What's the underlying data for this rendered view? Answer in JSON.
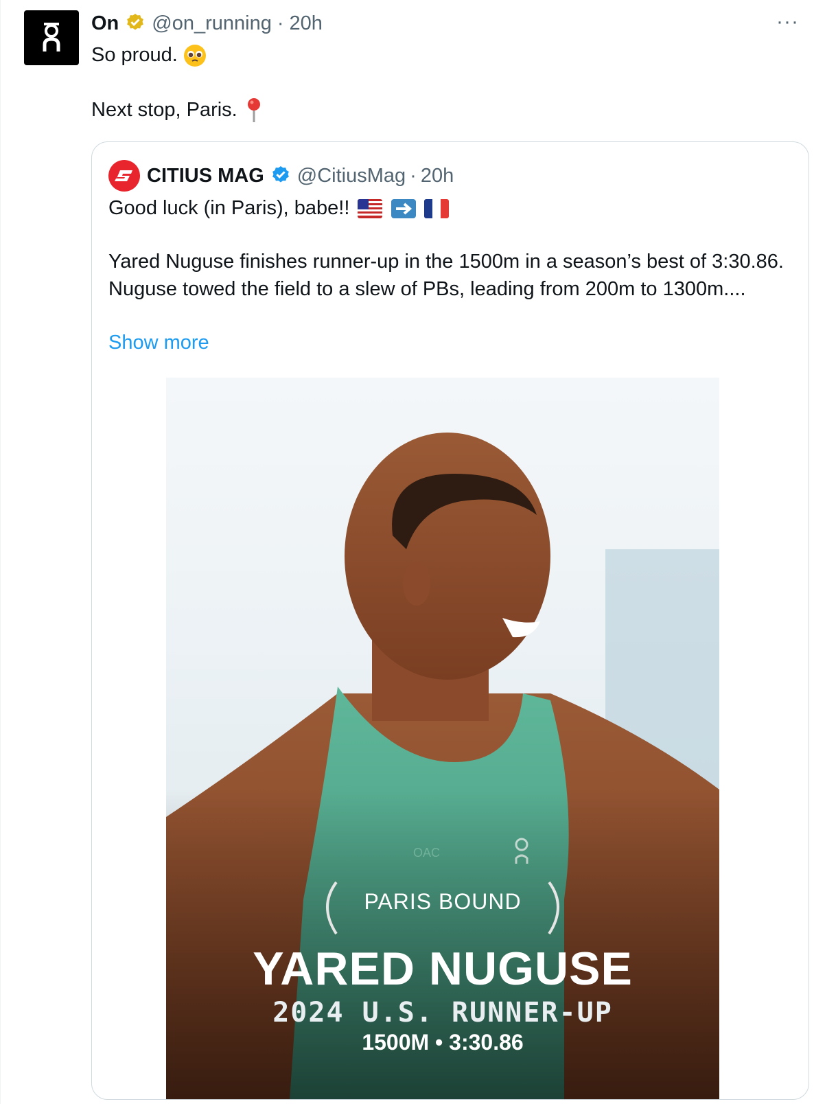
{
  "tweet": {
    "author_name": "On",
    "handle": "@on_running",
    "time": "20h",
    "more_label": "···",
    "line1": "So proud.",
    "line2": "Next stop, Paris."
  },
  "quote": {
    "author_name": "CITIUS MAG",
    "handle": "@CitiusMag",
    "time": "20h",
    "line1": "Good luck (in Paris), babe!!",
    "body": "Yared Nuguse finishes runner-up in the 1500m in a season’s best of 3:30.86. Nuguse towed the field to a slew of PBs, leading from 200m to 1300m....",
    "show_more": "Show more"
  },
  "media": {
    "label1": "PARIS BOUND",
    "label2": "YARED NUGUSE",
    "label3": "2024 U.S. RUNNER-UP",
    "label4": "1500M • 3:30.86",
    "singlet_text": "OAC"
  },
  "colors": {
    "verified_gold": "#e2b719",
    "verified_blue": "#1d9bf0",
    "link": "#1d9bf0",
    "citius_red": "#e8242c"
  }
}
